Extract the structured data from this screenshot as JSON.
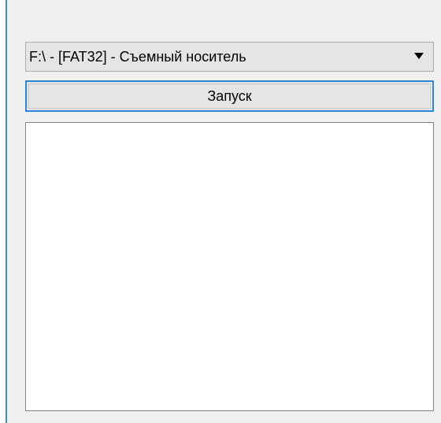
{
  "drive_select": {
    "selected_value": "F:\\ -  [FAT32] - Съемный носитель"
  },
  "run_button": {
    "label": "Запуск"
  },
  "output_list": {
    "items": []
  },
  "colors": {
    "window_background": "#f0f0f0",
    "focus_border": "#2b86d8",
    "control_background": "#e5e5e5"
  }
}
